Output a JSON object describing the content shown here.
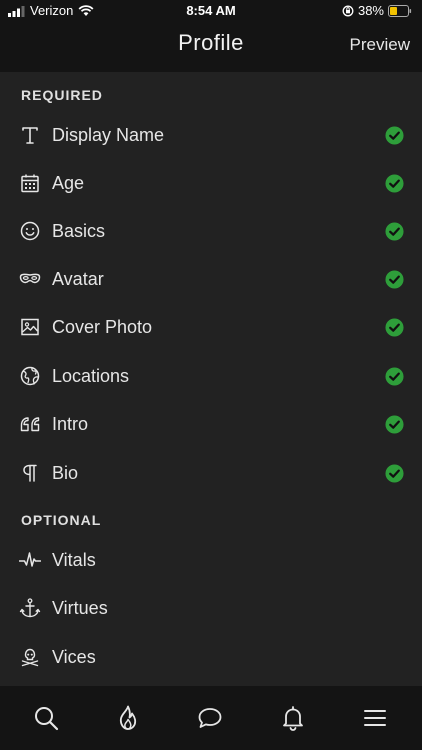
{
  "status": {
    "carrier": "Verizon",
    "time": "8:54 AM",
    "battery": "38%"
  },
  "nav": {
    "title": "Profile",
    "preview_label": "Preview"
  },
  "sections": {
    "required_label": "REQUIRED",
    "optional_label": "OPTIONAL"
  },
  "required_items": [
    {
      "label": "Display Name",
      "icon": "text-icon",
      "complete": true
    },
    {
      "label": "Age",
      "icon": "calendar-icon",
      "complete": true
    },
    {
      "label": "Basics",
      "icon": "smiley-icon",
      "complete": true
    },
    {
      "label": "Avatar",
      "icon": "mask-icon",
      "complete": true
    },
    {
      "label": "Cover Photo",
      "icon": "image-icon",
      "complete": true
    },
    {
      "label": "Locations",
      "icon": "globe-icon",
      "complete": true
    },
    {
      "label": "Intro",
      "icon": "quote-icon",
      "complete": true
    },
    {
      "label": "Bio",
      "icon": "pilcrow-icon",
      "complete": true
    }
  ],
  "optional_items": [
    {
      "label": "Vitals",
      "icon": "pulse-icon"
    },
    {
      "label": "Virtues",
      "icon": "anchor-icon"
    },
    {
      "label": "Vices",
      "icon": "skull-crossbones-icon"
    }
  ],
  "tabs": [
    {
      "name": "search-icon"
    },
    {
      "name": "flame-icon"
    },
    {
      "name": "chat-icon"
    },
    {
      "name": "bell-icon"
    },
    {
      "name": "menu-icon"
    }
  ],
  "colors": {
    "check": "#2e9e3a",
    "background": "#222222",
    "bar": "#141414"
  }
}
